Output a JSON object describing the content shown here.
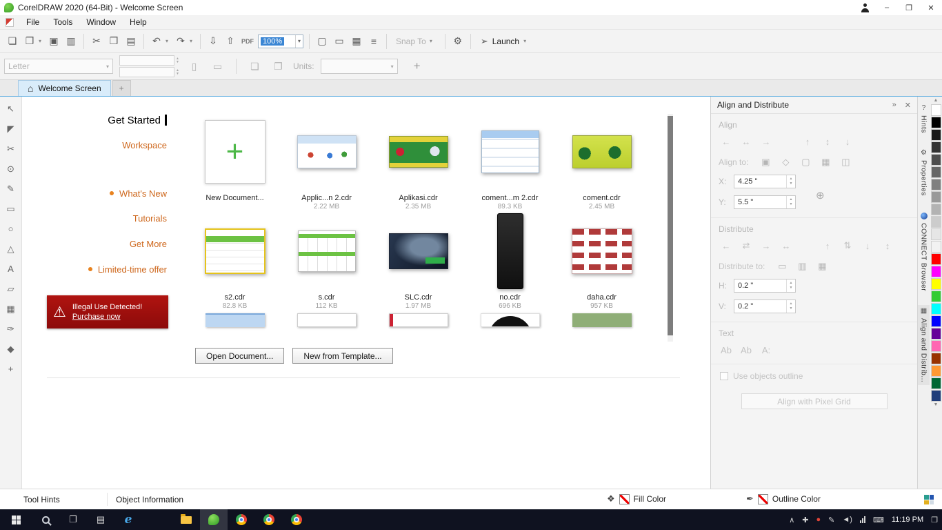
{
  "titlebar": {
    "app_title": "CorelDRAW 2020 (64-Bit) - Welcome Screen",
    "minimize_glyph": "–",
    "restore_glyph": "❐",
    "close_glyph": "✕"
  },
  "menubar": {
    "items": [
      "File",
      "Tools",
      "Window",
      "Help"
    ]
  },
  "toolbar": {
    "new_glyph": "❏",
    "open_glyph": "❐",
    "save_glyph": "▣",
    "print_glyph": "▥",
    "cut_glyph": "✂",
    "copy_glyph": "❒",
    "paste_glyph": "▤",
    "undo_glyph": "↶",
    "redo_glyph": "↷",
    "import_glyph": "⇩",
    "export_glyph": "⇧",
    "pdf_label": "PDF",
    "zoom_value": "100%",
    "fullscreen_glyph": "▢",
    "rulers_glyph": "▭",
    "grid_glyph": "▦",
    "guidelines_glyph": "≡",
    "snap_label": "Snap To",
    "options_glyph": "⚙",
    "launch_label": "Launch",
    "launch_glyph": "➢",
    "dropdown_glyph": "▾"
  },
  "propbar": {
    "page_size": "Letter",
    "units_label": "Units:",
    "portrait_glyph": "▯",
    "landscape_glyph": "▭",
    "single_page_glyph": "❏",
    "all_pages_glyph": "❐",
    "add_glyph": "+"
  },
  "tabbar": {
    "home_glyph": "⌂",
    "active_tab": "Welcome Screen",
    "new_tab_glyph": "+"
  },
  "toolbox": {
    "tools": [
      {
        "name": "pick",
        "glyph": "↖"
      },
      {
        "name": "shape",
        "glyph": "◤"
      },
      {
        "name": "crop",
        "glyph": "✂"
      },
      {
        "name": "zoom",
        "glyph": "⊙"
      },
      {
        "name": "freehand",
        "glyph": "✎"
      },
      {
        "name": "rectangle",
        "glyph": "▭"
      },
      {
        "name": "ellipse",
        "glyph": "○"
      },
      {
        "name": "polygon",
        "glyph": "△"
      },
      {
        "name": "text",
        "glyph": "A"
      },
      {
        "name": "parallel-dimension",
        "glyph": "▱"
      },
      {
        "name": "mesh-fill",
        "glyph": "▦"
      },
      {
        "name": "eyedropper",
        "glyph": "✑"
      },
      {
        "name": "interactive-fill",
        "glyph": "◆"
      },
      {
        "name": "more-tools",
        "glyph": "+"
      }
    ]
  },
  "welcome": {
    "nav": [
      {
        "label": "Get Started"
      },
      {
        "label": "Workspace"
      },
      {
        "label": "What's New"
      },
      {
        "label": "Tutorials"
      },
      {
        "label": "Get More"
      },
      {
        "label": "Limited-time offer"
      }
    ],
    "banner": {
      "warning_glyph": "⚠",
      "title": "Illegal Use Detected!",
      "link": "Purchase now"
    },
    "new_doc_plus": "+",
    "documents": [
      {
        "name": "New Document...",
        "size": ""
      },
      {
        "name": "Applic...n 2.cdr",
        "size": "2.22 MB"
      },
      {
        "name": "Aplikasi.cdr",
        "size": "2.35 MB"
      },
      {
        "name": "coment...m 2.cdr",
        "size": "89.3 KB"
      },
      {
        "name": "coment.cdr",
        "size": "2.45 MB"
      },
      {
        "name": "s2.cdr",
        "size": "82.8 KB"
      },
      {
        "name": "s.cdr",
        "size": "112 KB"
      },
      {
        "name": "SLC.cdr",
        "size": "1.97 MB"
      },
      {
        "name": "no.cdr",
        "size": "696 KB"
      },
      {
        "name": "daha.cdr",
        "size": "957 KB"
      }
    ],
    "open_document_button": "Open Document...",
    "new_from_template_button": "New from Template..."
  },
  "docker": {
    "title": "Align and Distribute",
    "expand_glyph": "»",
    "close_glyph": "✕",
    "align_heading": "Align",
    "align_icons": [
      "←",
      "↔",
      "→",
      "↑",
      "↕",
      "↓"
    ],
    "align_to_label": "Align to:",
    "align_to_icons": [
      "▣",
      "◇",
      "▢",
      "▦",
      "◫"
    ],
    "x_label": "X:",
    "x_value": "4.25 \"",
    "y_label": "Y:",
    "y_value": "5.5 \"",
    "anchor_glyph": "⊕",
    "spin_up": "▲",
    "spin_down": "▼",
    "distribute_heading": "Distribute",
    "distribute_icons": [
      "←",
      "⇄",
      "→",
      "↔",
      "↑",
      "⇅",
      "↓",
      "↕"
    ],
    "distribute_to_label": "Distribute to:",
    "distribute_to_icons": [
      "▭",
      "▥",
      "▦"
    ],
    "h_label": "H:",
    "h_value": "0.2 \"",
    "v_label": "V:",
    "v_value": "0.2 \"",
    "text_heading": "Text",
    "text_icons": [
      "Ab",
      "Ab",
      "A:"
    ],
    "outline_checkbox_label": "Use objects outline",
    "pixel_grid_button": "Align with Pixel Grid"
  },
  "side_tabs": {
    "tabs": [
      {
        "label": "Hints",
        "icon_glyph": "?"
      },
      {
        "label": "Properties",
        "icon_glyph": "⚙"
      },
      {
        "label": "CONNECT Browser",
        "icon_glyph": ""
      },
      {
        "label": "Align and Distrib...",
        "icon_glyph": "▦"
      }
    ]
  },
  "palette": {
    "up_glyph": "▲",
    "down_glyph": "▼",
    "colors": [
      "#FFFFFF",
      "#000000",
      "#1A1A1A",
      "#333333",
      "#4D4D4D",
      "#666666",
      "#808080",
      "#999999",
      "#B3B3B3",
      "#CCCCCC",
      "#E6E6E6",
      "#F2F2F2",
      "#FF0000",
      "#FF00FF",
      "#FFFF00",
      "#33CC33",
      "#00FFFF",
      "#0000FF",
      "#660099",
      "#FF66B2",
      "#993300",
      "#FF9933",
      "#006633",
      "#1F3D7A"
    ]
  },
  "statusbar": {
    "tool_hints": "Tool Hints",
    "object_information": "Object Information",
    "fill_icon_glyph": "❖",
    "fill_label": "Fill Color",
    "outline_icon_glyph": "✒",
    "outline_label": "Outline Color"
  },
  "taskbar": {
    "taskview_glyph": "❐",
    "tablet_glyph": "▤",
    "edge_glyph": "e",
    "tray": {
      "hidden_glyph": "∧",
      "shield_glyph": "✚",
      "badge_glyph": "●",
      "pen_glyph": "✎",
      "volume_glyph": "◄)",
      "keyboard_glyph": "⌨",
      "notification_glyph": "❒"
    },
    "time": "11:19 PM"
  }
}
